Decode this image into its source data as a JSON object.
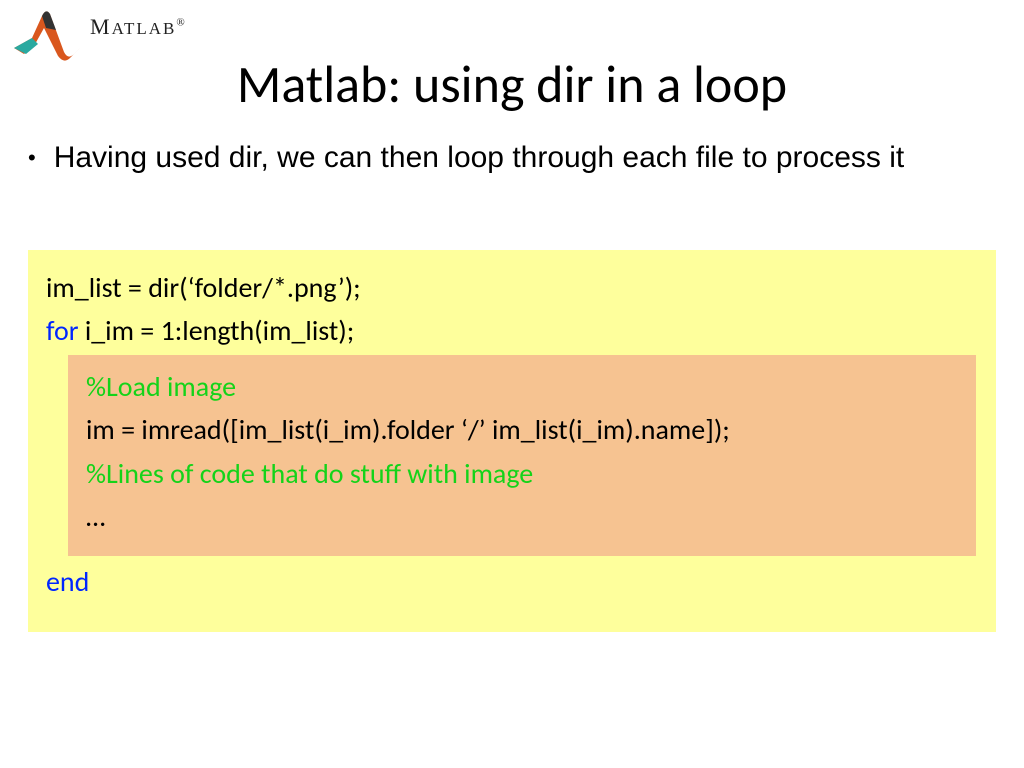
{
  "logo": {
    "brand": "M",
    "brand_rest": "ATLAB",
    "reg": "®"
  },
  "title": "Matlab: using dir in a loop",
  "bullet": "Having used dir, we can then loop through each file to process it",
  "code": {
    "line1": "im_list = dir(‘folder/*.png’);",
    "line2_kw": "for",
    "line2_rest": " i_im = 1:length(im_list);",
    "inner_comment1": "%Load image",
    "inner_line2": "im = imread([im_list(i_im).folder ‘/’ im_list(i_im).name]);",
    "inner_comment2": " %Lines of code that do stuff with image",
    "inner_ellipsis": "…",
    "line_end": "end"
  }
}
